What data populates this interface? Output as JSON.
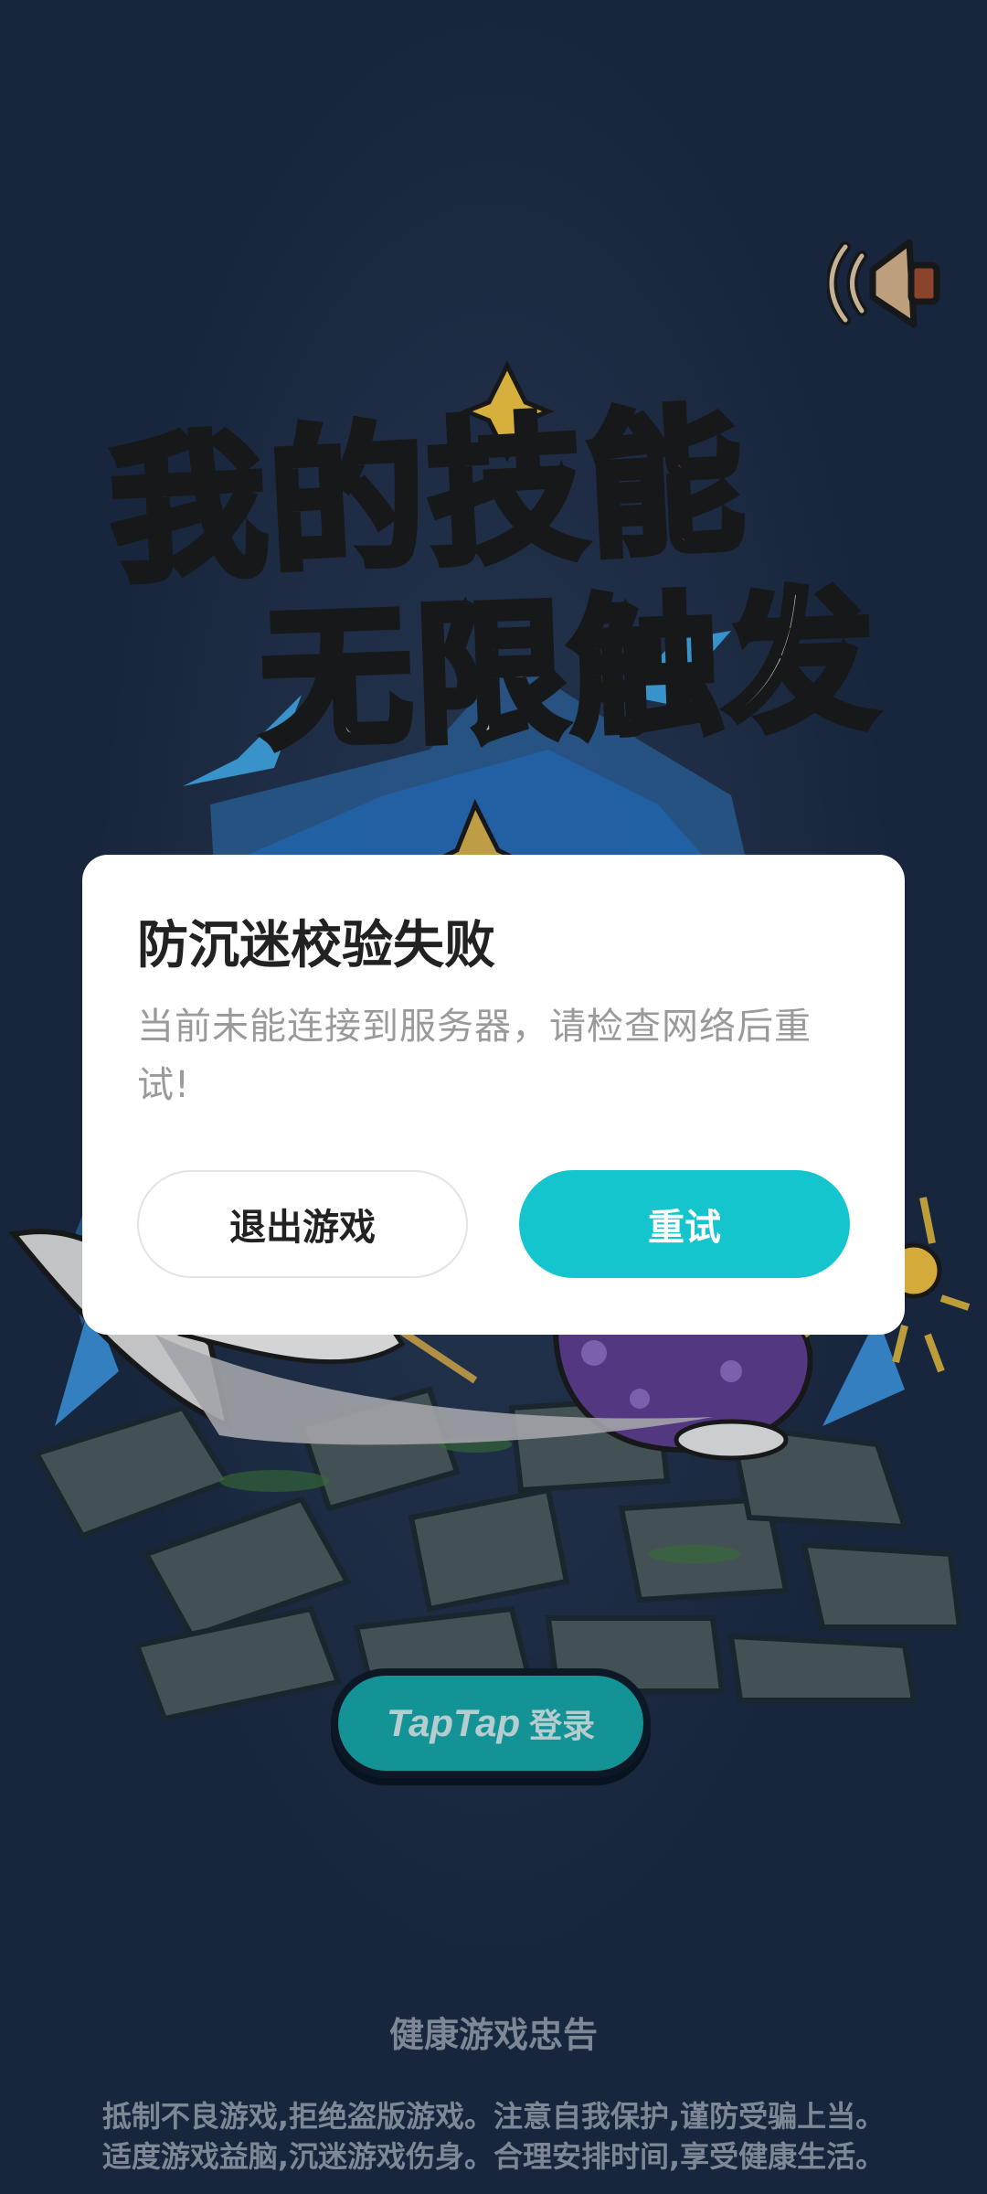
{
  "game": {
    "title_line1": "我的技能",
    "title_line2": "无限触发"
  },
  "icons": {
    "sound": "speaker-icon"
  },
  "dialog": {
    "title": "防沉迷校验失败",
    "message": "当前未能连接到服务器，请检查网络后重试!",
    "exit_label": "退出游戏",
    "retry_label": "重试",
    "retry_color": "#15c5ce"
  },
  "login": {
    "brand": "TapTap",
    "label": "登录",
    "color": "#16a5a8"
  },
  "notice": {
    "title": "健康游戏忠告",
    "line1": "抵制不良游戏,拒绝盗版游戏。注意自我保护,谨防受骗上当。",
    "line2": "适度游戏益脑,沉迷游戏伤身。合理安排时间,享受健康生活。"
  }
}
